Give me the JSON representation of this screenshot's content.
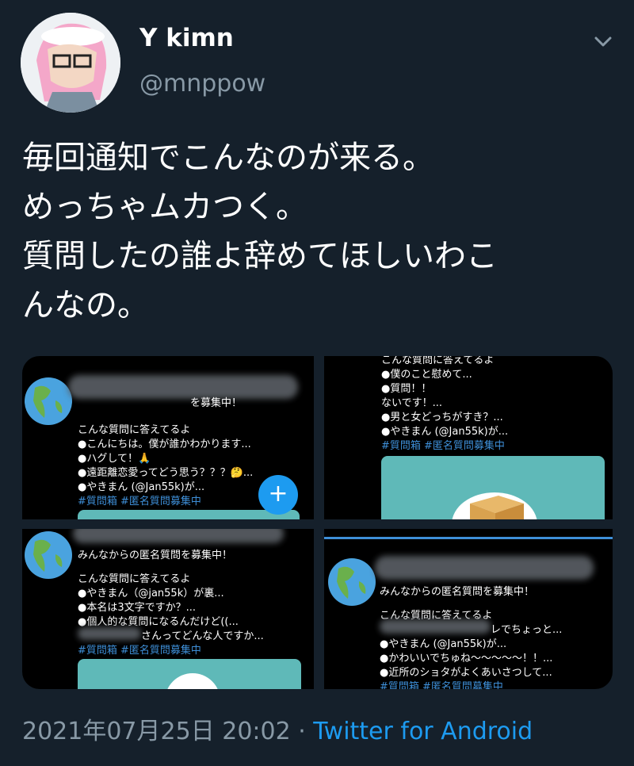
{
  "user": {
    "display_name": "Y kimn",
    "handle": "@mnppow"
  },
  "tweet": {
    "lines": [
      "毎回通知でこんなのが来る。",
      "めっちゃムカつく。",
      "質問したの誰よ辞めてほしいわこ",
      "んなの。"
    ],
    "timestamp": "2021年07月25日 20:02",
    "separator": " · ",
    "source": "Twitter for Android"
  },
  "media": {
    "tile1": {
      "header": "を募集中！",
      "intro": "こんな質問に答えてるよ",
      "items": [
        "●こんにちは。僕が誰かわかります...",
        "●ハグして！🙏",
        "●遠距離恋愛ってどう思う？？？🤔...",
        "●やきまん (@Jan55k)が..."
      ],
      "tags": "#質問箱 #匿名質問募集中",
      "fab": "+"
    },
    "tile2": {
      "top": "こんな質問に答えてるよ",
      "items": [
        "●僕のこと慰めて...",
        "●質問！！",
        "ないです！...",
        "●男と女どっちがすき？...",
        "●やきまん (@Jan55k)が..."
      ],
      "tags": "#質問箱 #匿名質問募集中"
    },
    "tile3": {
      "header": "みんなからの匿名質問を募集中！",
      "intro": "こんな質問に答えてるよ",
      "items": [
        "●やきまん（@jan55k）が裏...",
        "●本名は3文字ですか？...",
        "●個人的な質問になるんだけど((...",
        "さんってどんな人ですか..."
      ],
      "tags": "#質問箱 #匿名質問募集中"
    },
    "tile4": {
      "header": "みんなからの匿名質問を募集中！",
      "intro": "こんな質問に答えてるよ",
      "items": [
        "レでちょっと...",
        "●やきまん (@Jan55k)が...",
        "●かわいいでちゅね〜〜〜〜〜！！...",
        "●近所のショタがよくあいさつして..."
      ],
      "tags": "#質問箱 #匿名質問募集中"
    }
  }
}
